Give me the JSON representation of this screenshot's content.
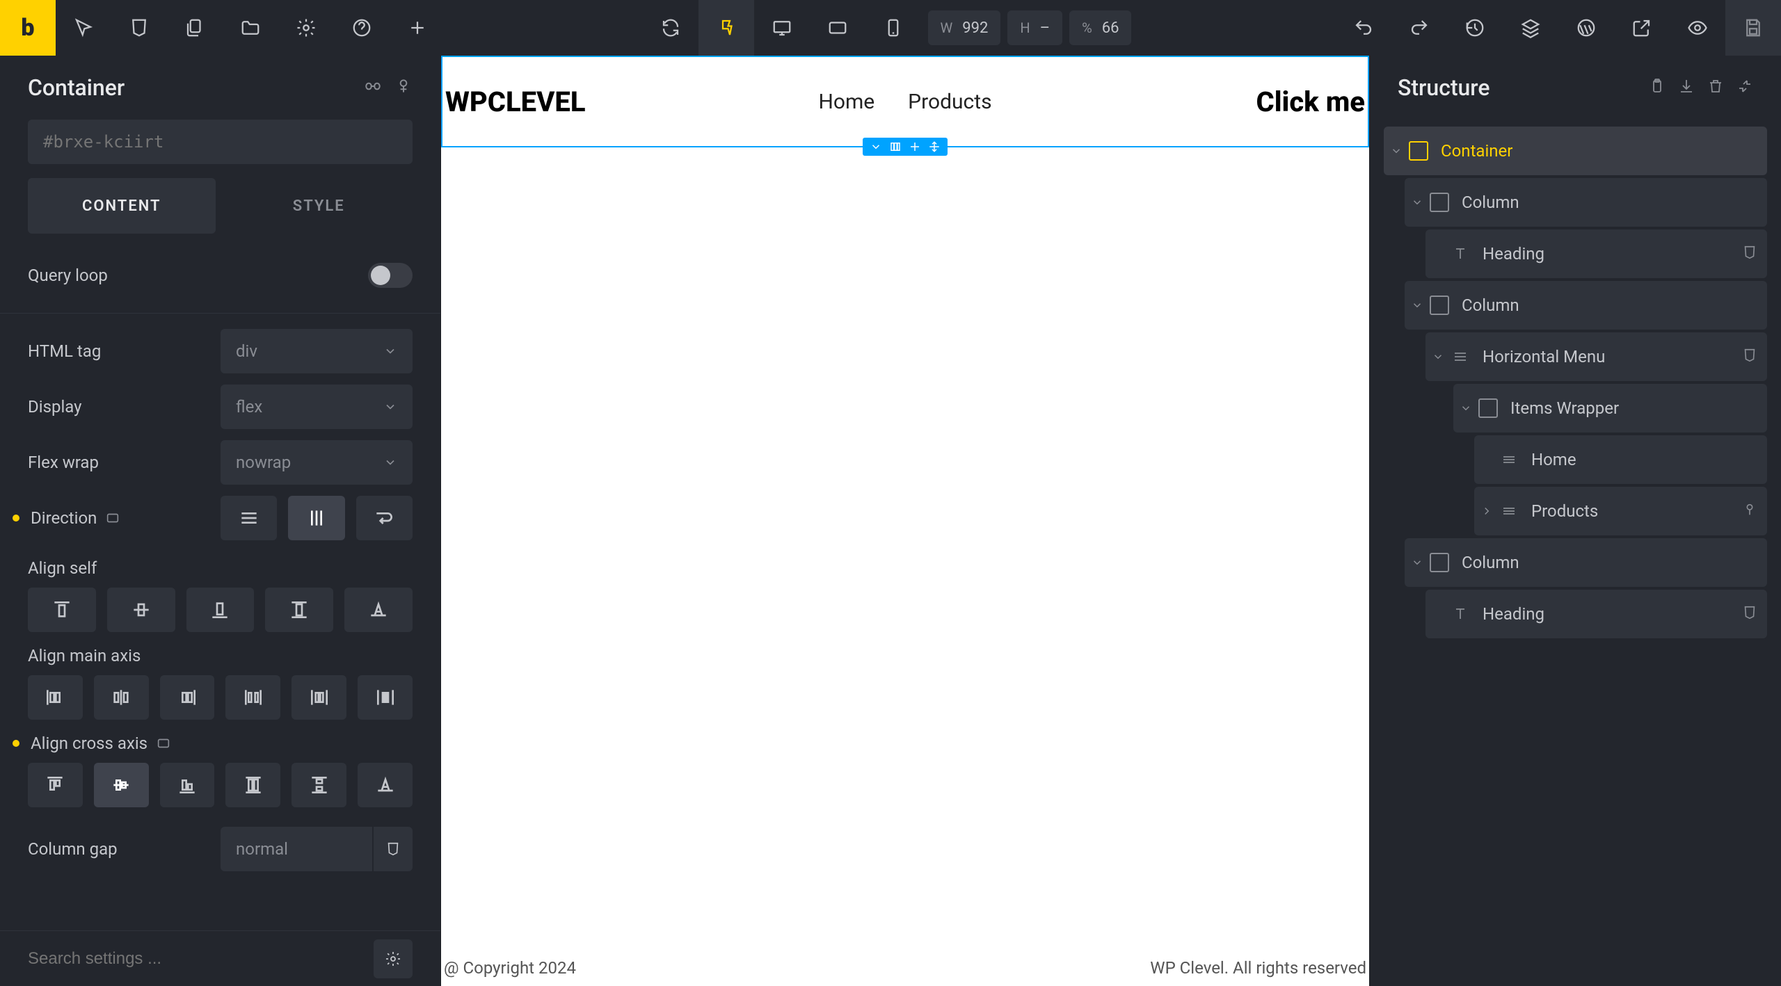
{
  "topbar": {
    "logo": "b",
    "width_label": "W",
    "width_value": "992",
    "height_label": "H",
    "height_value": "–",
    "percent_label": "%",
    "percent_value": "66"
  },
  "left_panel": {
    "title": "Container",
    "id_placeholder": "#brxe-kciirt",
    "tabs": {
      "content": "CONTENT",
      "style": "STYLE"
    },
    "query_loop": "Query loop",
    "html_tag_label": "HTML tag",
    "html_tag_value": "div",
    "display_label": "Display",
    "display_value": "flex",
    "flex_wrap_label": "Flex wrap",
    "flex_wrap_value": "nowrap",
    "direction_label": "Direction",
    "align_self_label": "Align self",
    "align_main_label": "Align main axis",
    "align_cross_label": "Align cross axis",
    "column_gap_label": "Column gap",
    "column_gap_value": "normal",
    "search_placeholder": "Search settings ..."
  },
  "canvas": {
    "brand": "WPCLEVEL",
    "menu": {
      "home": "Home",
      "products": "Products"
    },
    "cta": "Click me",
    "footer_left": "@ Copyright 2024",
    "footer_right": "WP Clevel. All rights reserved"
  },
  "right_panel": {
    "title": "Structure",
    "tree": {
      "container": "Container",
      "col1": "Column",
      "heading1": "Heading",
      "col2": "Column",
      "hmenu": "Horizontal Menu",
      "items_wrapper": "Items Wrapper",
      "home": "Home",
      "products": "Products",
      "col3": "Column",
      "heading2": "Heading"
    }
  }
}
